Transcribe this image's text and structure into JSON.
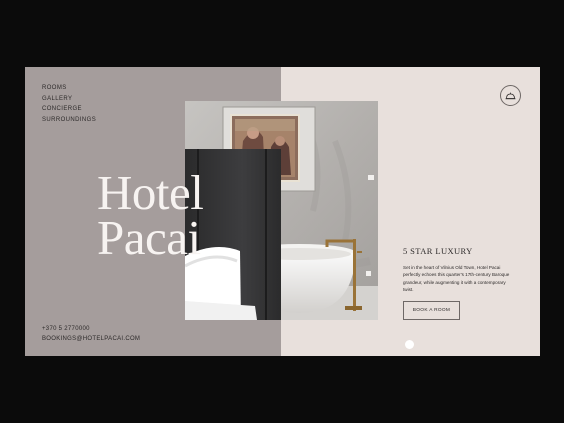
{
  "nav": {
    "items": [
      "ROOMS",
      "GALLERY",
      "CONCIERGE",
      "SURROUNDINGS"
    ]
  },
  "hero": {
    "title_line1": "Hotel",
    "title_line2": "Pacai"
  },
  "contact": {
    "phone": "+370 5 2770000",
    "email": "BOOKINGS@HOTELPACAI.COM"
  },
  "info": {
    "subtitle": "5 STAR LUXURY",
    "description": "Set in the heart of Vilnius Old Town, Hotel Pacai perfectly echoes this quarter's 17th-century Baroque grandeur, while augmenting it with a contemporary twist."
  },
  "actions": {
    "book_label": "BOOK A ROOM"
  },
  "icons": {
    "concierge": "concierge-bell-icon",
    "slider": "slider-dot-indicator"
  },
  "colors": {
    "background": "#0b0b0b",
    "left_panel": "#a59d9c",
    "right_panel": "#e8e0dc",
    "text": "#2d2a2a",
    "title": "#f7f3f1"
  }
}
